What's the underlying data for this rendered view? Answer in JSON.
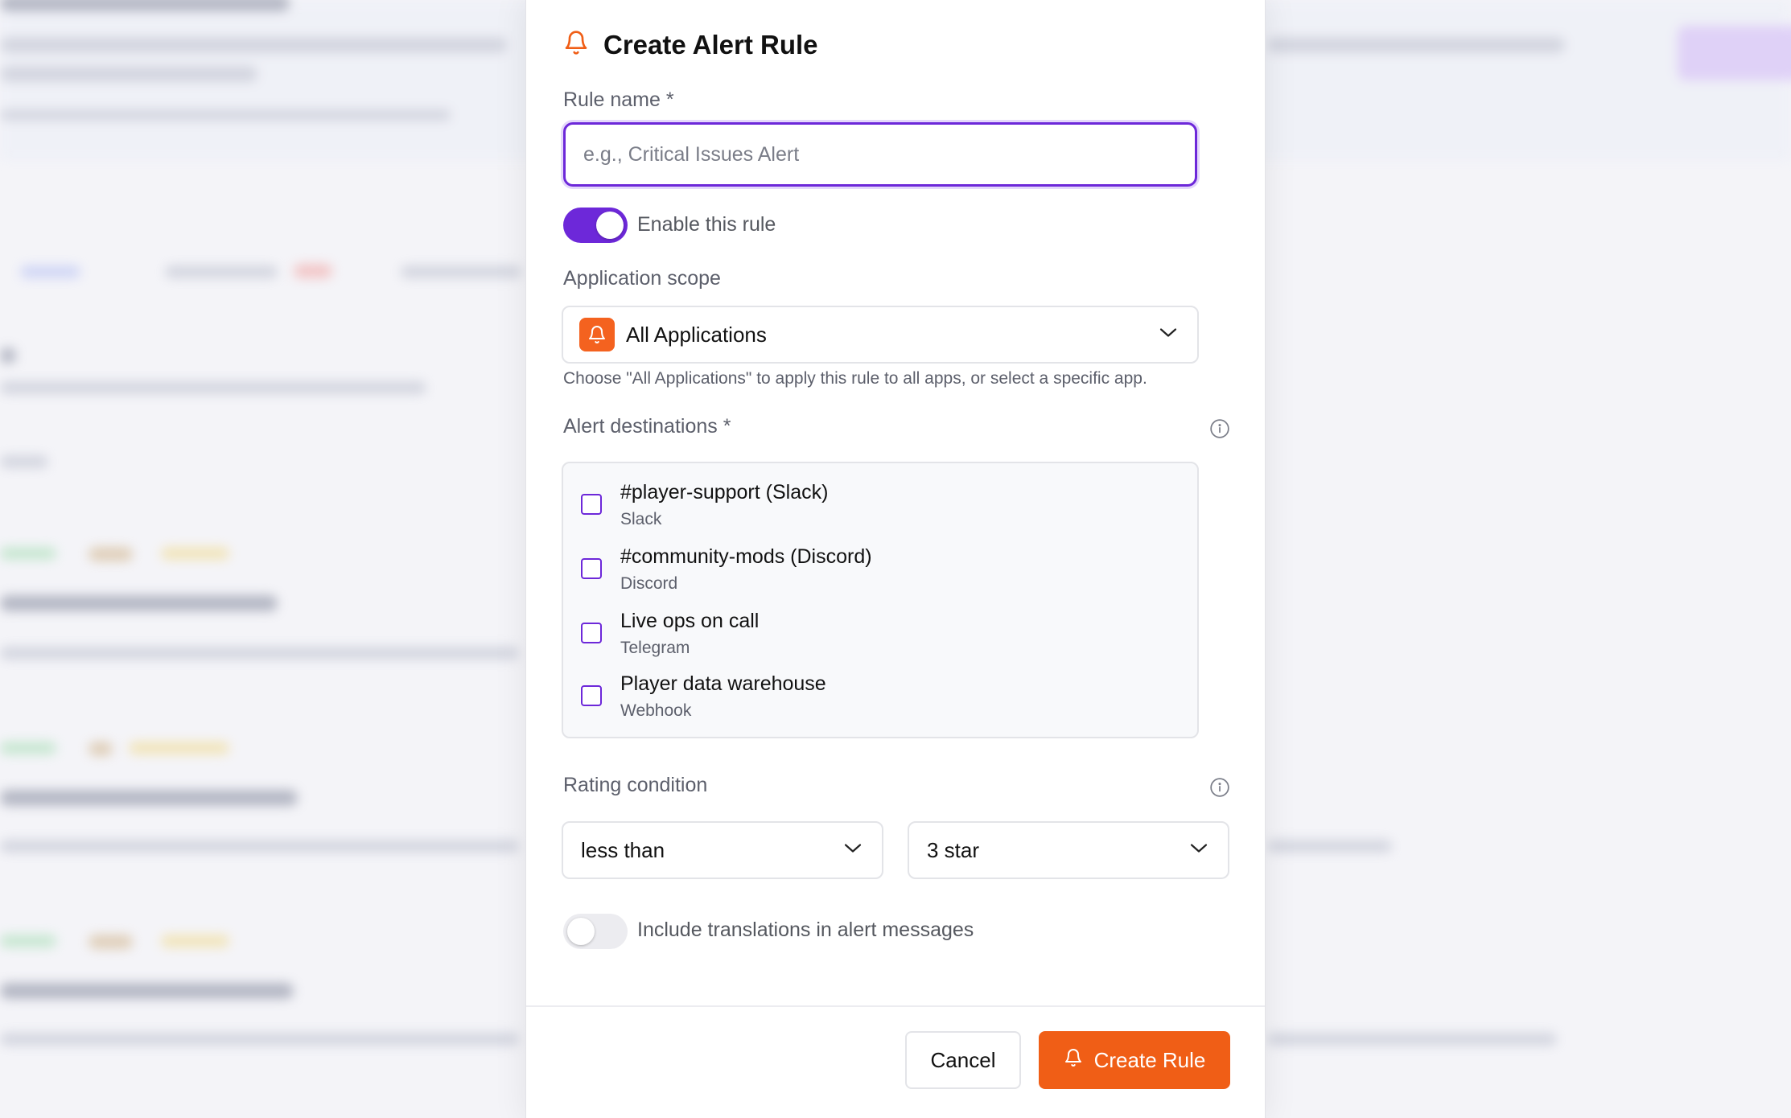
{
  "modal": {
    "title": "Create Alert Rule",
    "rule_name": {
      "label": "Rule name *",
      "placeholder": "e.g., Critical Issues Alert",
      "value": ""
    },
    "enable_rule": {
      "label": "Enable this rule",
      "on": true
    },
    "application_scope": {
      "label": "Application scope",
      "selected": "All Applications",
      "help": "Choose \"All Applications\" to apply this rule to all apps, or select a specific app."
    },
    "alert_destinations": {
      "label": "Alert destinations *",
      "items": [
        {
          "name": "#player-support (Slack)",
          "type": "Slack",
          "checked": false
        },
        {
          "name": "#community-mods (Discord)",
          "type": "Discord",
          "checked": false
        },
        {
          "name": "Live ops on call",
          "type": "Telegram",
          "checked": false
        },
        {
          "name": "Player data warehouse",
          "type": "Webhook",
          "checked": false
        }
      ]
    },
    "rating_condition": {
      "label": "Rating condition",
      "operator": "less than",
      "value": "3 star"
    },
    "include_translations": {
      "label": "Include translations in alert messages",
      "on": false
    },
    "buttons": {
      "cancel": "Cancel",
      "create": "Create Rule"
    }
  },
  "colors": {
    "accent_purple": "#6d28d9",
    "accent_orange": "#f05e16"
  }
}
